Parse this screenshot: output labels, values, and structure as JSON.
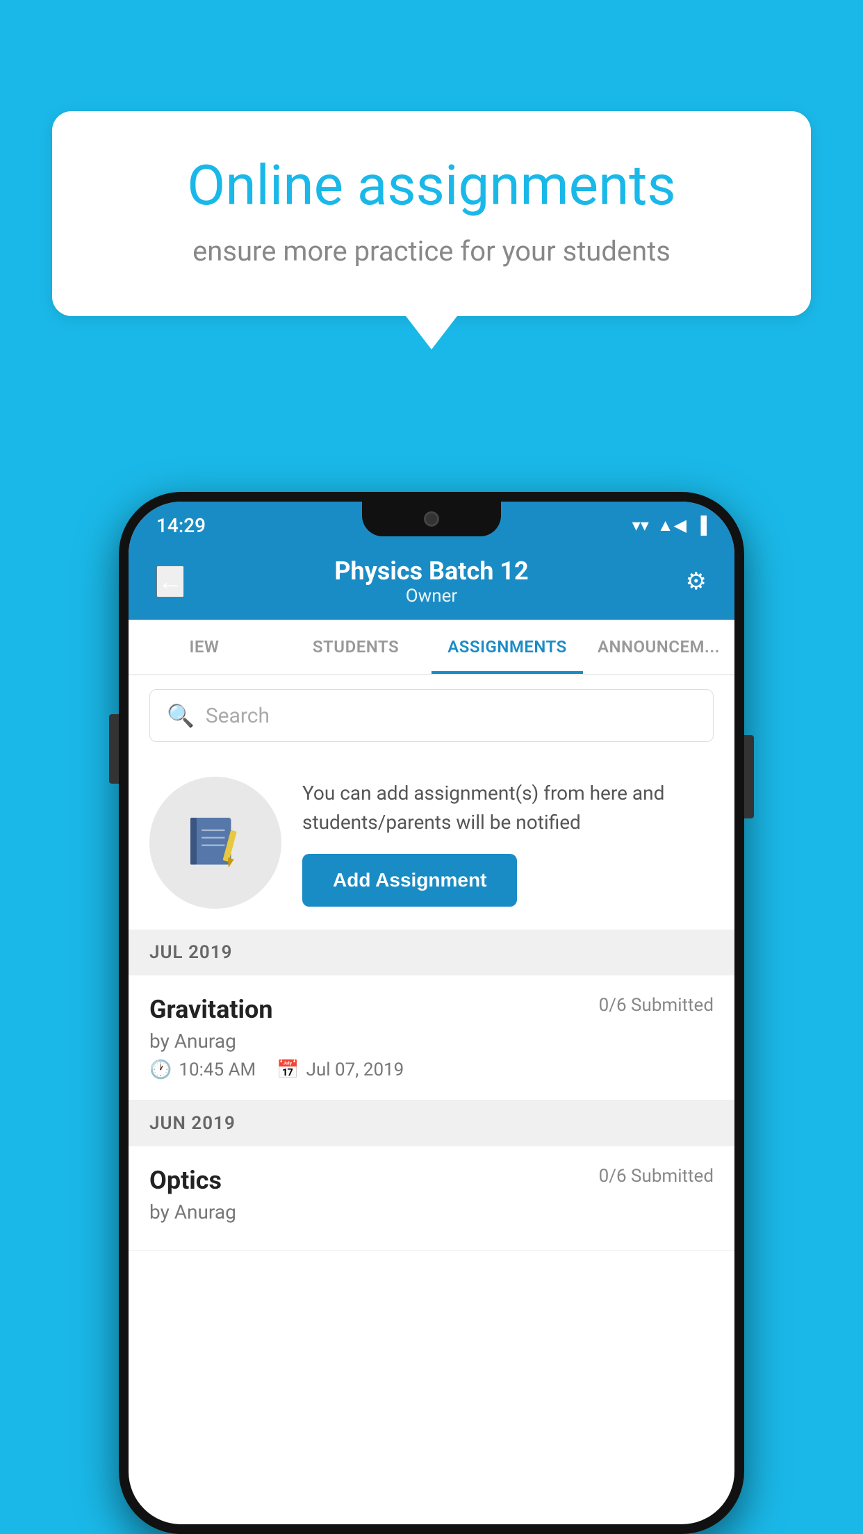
{
  "background_color": "#1ab8e8",
  "speech_bubble": {
    "title": "Online assignments",
    "subtitle": "ensure more practice for your students"
  },
  "status_bar": {
    "time": "14:29",
    "wifi": "▼",
    "signal": "▲",
    "battery": "▌"
  },
  "header": {
    "title": "Physics Batch 12",
    "subtitle": "Owner",
    "back_label": "←",
    "settings_label": "⚙"
  },
  "tabs": [
    {
      "label": "IEW",
      "active": false
    },
    {
      "label": "STUDENTS",
      "active": false
    },
    {
      "label": "ASSIGNMENTS",
      "active": true
    },
    {
      "label": "ANNOUNCEM...",
      "active": false
    }
  ],
  "search": {
    "placeholder": "Search"
  },
  "promo": {
    "description": "You can add assignment(s) from here and students/parents will be notified",
    "button_label": "Add Assignment"
  },
  "sections": [
    {
      "month": "JUL 2019",
      "assignments": [
        {
          "name": "Gravitation",
          "submitted": "0/6 Submitted",
          "author": "by Anurag",
          "time": "10:45 AM",
          "date": "Jul 07, 2019"
        }
      ]
    },
    {
      "month": "JUN 2019",
      "assignments": [
        {
          "name": "Optics",
          "submitted": "0/6 Submitted",
          "author": "by Anurag",
          "time": "",
          "date": ""
        }
      ]
    }
  ]
}
